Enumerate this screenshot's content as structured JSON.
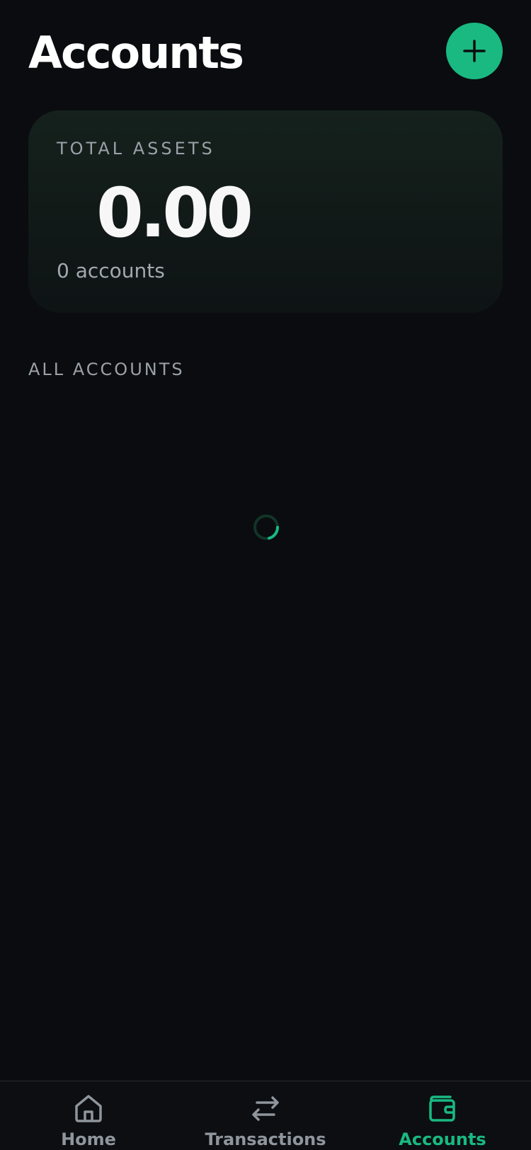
{
  "header": {
    "title": "Accounts",
    "add_icon": "plus-icon"
  },
  "summary": {
    "label": "TOTAL ASSETS",
    "amount": "0.00",
    "count": "0 accounts"
  },
  "section": {
    "title": "ALL ACCOUNTS"
  },
  "loading": {
    "icon": "loading-spinner-icon"
  },
  "nav": {
    "items": [
      {
        "label": "Home",
        "icon": "home-icon",
        "active": false
      },
      {
        "label": "Transactions",
        "icon": "arrows-exchange-icon",
        "active": false
      },
      {
        "label": "Accounts",
        "icon": "wallet-icon",
        "active": true
      }
    ]
  },
  "colors": {
    "accent": "#19b981",
    "background": "#0a0c0f",
    "muted_text": "#9aa1a8"
  }
}
